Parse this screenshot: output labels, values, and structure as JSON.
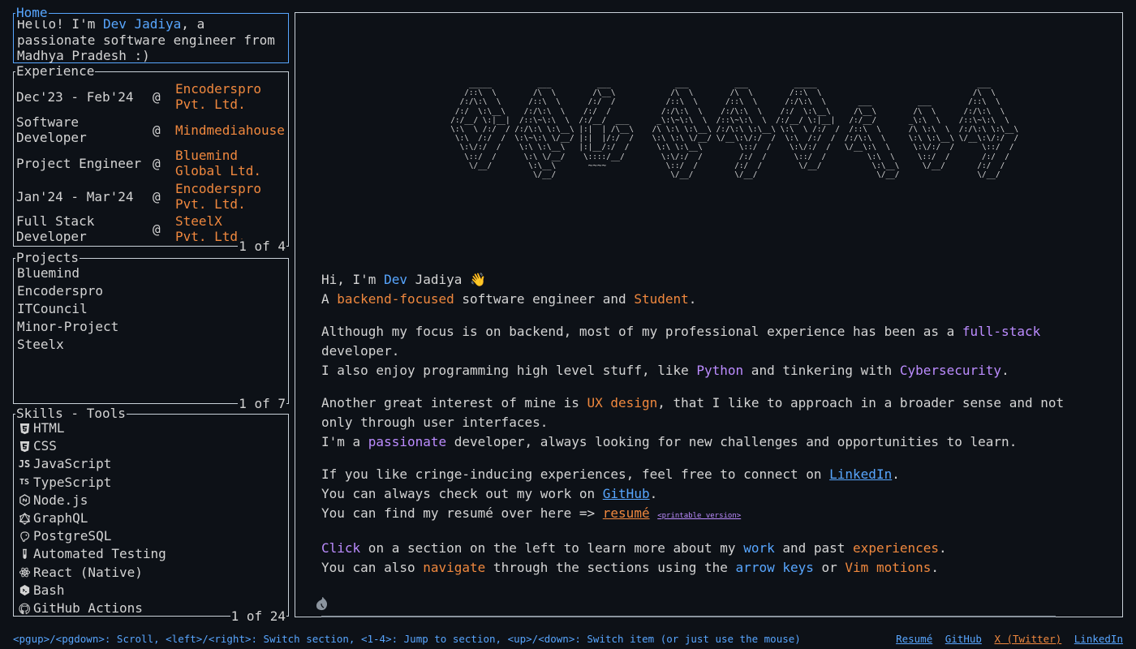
{
  "home": {
    "title": "Home",
    "greet": "Hello! I'm ",
    "name": "Dev Jadiya",
    "rest1": ", a",
    "rest2": "passionate software engineer from",
    "rest3": "Madhya Pradesh :)"
  },
  "experience": {
    "title": "Experience",
    "counter": "1 of 4",
    "items": [
      {
        "role1": "Dec'23 - Feb'24",
        "role2": "",
        "at": "@",
        "co1": "Encoderspro",
        "co2": "Pvt. Ltd."
      },
      {
        "role1": "Software",
        "role2": "Developer",
        "at": "@",
        "co1": "Mindmediahouse",
        "co2": ""
      },
      {
        "role1": "Project Engineer",
        "role2": "",
        "at": "@",
        "co1": "Bluemind",
        "co2": "Global Ltd."
      },
      {
        "role1": "Jan'24 - Mar'24",
        "role2": "",
        "at": "@",
        "co1": "Encoderspro",
        "co2": "Pvt. Ltd."
      },
      {
        "role1": "Full Stack",
        "role2": "Developer",
        "at": "@",
        "co1": "SteelX",
        "co2": "Pvt. Ltd."
      }
    ]
  },
  "projects": {
    "title": "Projects",
    "counter": "1 of 7",
    "items": [
      "Bluemind",
      "Encoderspro",
      "ITCouncil",
      "Minor-Project",
      "Steelx"
    ]
  },
  "skills": {
    "title": "Skills - Tools",
    "counter": "1 of 24",
    "items": [
      {
        "label": "HTML",
        "icon": "html5-icon"
      },
      {
        "label": "CSS",
        "icon": "css3-icon"
      },
      {
        "label": "JavaScript",
        "icon": "js-icon"
      },
      {
        "label": "TypeScript",
        "icon": "ts-icon"
      },
      {
        "label": "Node.js",
        "icon": "nodejs-icon"
      },
      {
        "label": "GraphQL",
        "icon": "graphql-icon"
      },
      {
        "label": "PostgreSQL",
        "icon": "postgresql-icon"
      },
      {
        "label": "Automated Testing",
        "icon": "test-tube-icon"
      },
      {
        "label": "React (Native)",
        "icon": "react-icon"
      },
      {
        "label": "Bash",
        "icon": "bash-icon"
      },
      {
        "label": "GitHub Actions",
        "icon": "github-icon"
      }
    ],
    "glyph_js": "JS",
    "glyph_ts": "TS"
  },
  "ascii": "      _____          ___          ___              ___          ___          _____                                   ___     \n     /::\\  \\        /\\  \\        /\\__\\            /\\  \\        /\\  \\        /::\\  \\                                 /\\  \\    \n    /:/\\:\\  \\      /::\\  \\      /:/  /           /::\\  \\      /::\\  \\      /:/\\:\\  \\       ___          ___        /::\\  \\   \n   /:/  \\:\\__\\    /:/\\:\\  \\    /:/  /           /:/\\:\\  \\    /:/\\:\\  \\    /:/  \\:\\__\\     /\\__\\        /\\  \\      /:/\\:\\  \\  \n  /:/__/ \\:|__|  /::\\~\\:\\  \\  /:/__/  ___      _\\:\\~\\:\\  \\  /::\\~\\:\\  \\  /:/__/ \\:|__|   /:/__/       _\\:\\  \\    /::\\~\\:\\  \\ \n  \\:\\  \\ /:/  / /:/\\:\\ \\:\\__\\ |:|  | /\\__\\    /\\ \\:\\ \\:\\__\\ /:/\\:\\ \\:\\__\\ \\:\\  \\ /:/  /  /::\\  \\      /\\ \\:\\  \\  /:/\\:\\ \\:\\__\\\n   \\:\\  /:/  /  \\:\\~\\:\\ \\/__/ |:|  |/:/  /    \\:\\ \\:\\ \\/__/ \\/__\\:\\/:/  /  \\:\\  /:/  /  /:/\\:\\  \\     \\:\\ \\:\\__\\ \\/__\\:\\/:/  /\n    \\:\\/:/  /    \\:\\ \\:\\__\\   |:|__/:/  /      \\:\\ \\:\\__\\        \\::/  /    \\:\\/:/  /   \\/__\\:\\  \\     \\:\\/:/  /      \\::/  / \n     \\::/  /      \\:\\ \\/__/    \\::::/__/        \\:\\/:/  /        /:/  /      \\::/  /         \\:\\  \\     \\::/  /       /:/  /  \n      \\/__/        \\:\\__\\       ~~~~             \\::/  /        /:/  /        \\/__/           \\:\\__\\     \\/__/       /:/  /   \n                    \\/__/                         \\/__/         \\/__/                          \\/__/                 \\/__/    ",
  "about": {
    "l1a": "Hi, I'm ",
    "l1b": "Dev",
    "l1c": " Jadiya ",
    "l1d": "👋",
    "l2a": "A ",
    "l2b": "backend-focused",
    "l2c": " software engineer and ",
    "l2d": "Student",
    "l2e": ".",
    "p2a": "Although my focus is on backend, most of my professional experience has been as a ",
    "p2b": "full-stack",
    "p2c": " developer.",
    "p2d": "I also enjoy programming high level stuff, like ",
    "p2e": "Python",
    "p2f": " and tinkering with ",
    "p2g": "Cybersecurity",
    "p2h": ".",
    "p3a": "Another great interest of mine is ",
    "p3b": "UX design",
    "p3c": ", that I like to approach in a broader sense and not only through user interfaces.",
    "p3d": "I'm a ",
    "p3e": "passionate",
    "p3f": " developer, always looking for new challenges and opportunities to learn.",
    "p4a": "If you like cringe-inducing experiences, feel free to connect on ",
    "p4b": "LinkedIn",
    "p4c": ".",
    "p4d": "You can always check out my work on ",
    "p4e": "GitHub",
    "p4f": ".",
    "p4g": "You can find my resumé over here => ",
    "p4h": "resumé",
    "p4i": "<printable version>",
    "p5a": "Click",
    "p5b": " on a section on the left to learn more about my ",
    "p5c": "work",
    "p5d": " and past ",
    "p5e": "experiences",
    "p5f": ".",
    "p5g": "You can also ",
    "p5h": "navigate",
    "p5i": " through the sections using the ",
    "p5j": "arrow keys",
    "p5k": " or ",
    "p5l": "Vim motions",
    "p5m": "."
  },
  "footer": {
    "help": "<pgup>/<pgdown>: Scroll, <left>/<right>: Switch section, <1-4>: Jump to section, <up>/<down>: Switch item (or just use the mouse)",
    "resume": "Resumé",
    "github": "GitHub",
    "twitter": "X (Twitter)",
    "linkedin": "LinkedIn"
  },
  "colors": {
    "accent": "#58a6ff",
    "orange": "#f0883e",
    "purple": "#bc8cff",
    "background": "#0d1117"
  }
}
